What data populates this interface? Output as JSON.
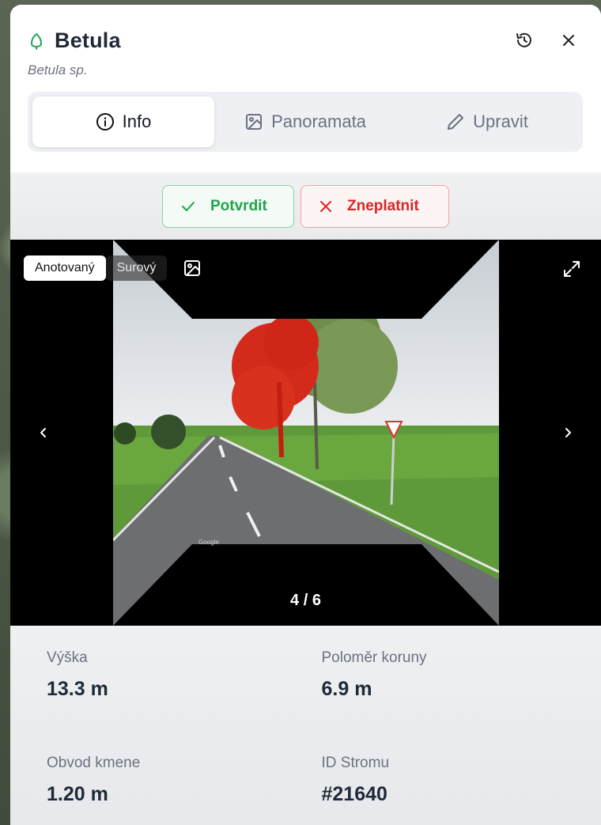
{
  "panel": {
    "title": "Betula",
    "subtitle": "Betula sp.",
    "icons": {
      "tree": "tree-icon",
      "history": "history-icon",
      "close": "close-icon"
    }
  },
  "tabs": [
    {
      "label": "Info",
      "icon": "info-icon",
      "active": true
    },
    {
      "label": "Panoramata",
      "icon": "image-icon",
      "active": false
    },
    {
      "label": "Upravit",
      "icon": "pencil-icon",
      "active": false
    }
  ],
  "actions": {
    "confirm_label": "Potvrdit",
    "reject_label": "Zneplatnit",
    "confirm_color": "#1ea34a",
    "reject_color": "#dc2626"
  },
  "viewer": {
    "toggle_annotated": "Anotovaný",
    "toggle_raw": "Surový",
    "counter": "4 / 6",
    "watermark": "Google"
  },
  "stats": {
    "height_label": "Výška",
    "height_value": "13.3 m",
    "crown_label": "Poloměr koruny",
    "crown_value": "6.9 m",
    "trunk_label": "Obvod kmene",
    "trunk_value": "1.20 m",
    "id_label": "ID Stromu",
    "id_value": "#21640"
  }
}
